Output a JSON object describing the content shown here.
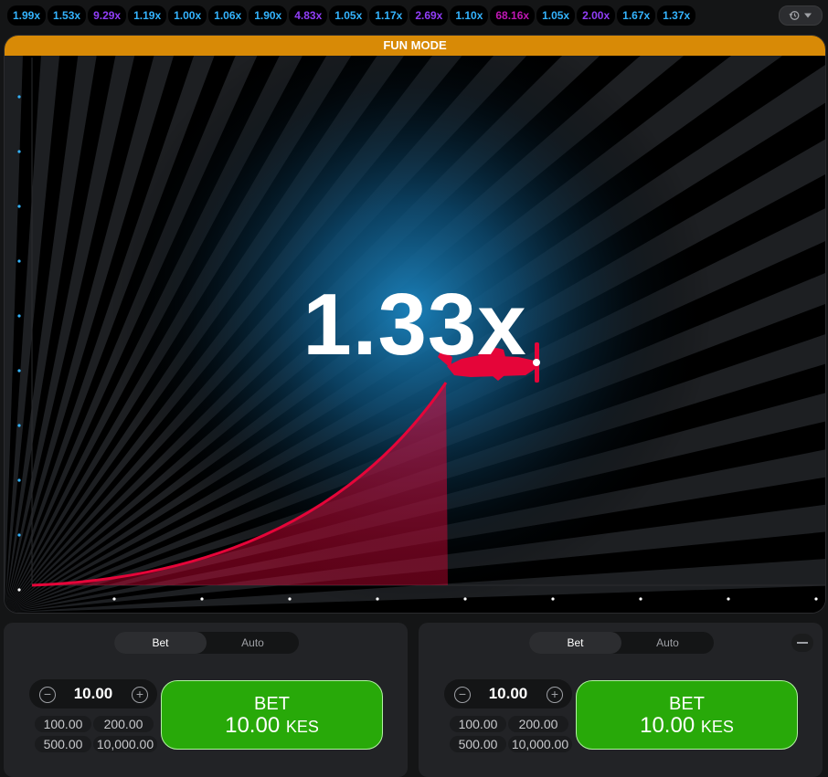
{
  "history": {
    "items": [
      {
        "label": "1.99x",
        "tier": "blue"
      },
      {
        "label": "1.53x",
        "tier": "blue"
      },
      {
        "label": "9.29x",
        "tier": "purple"
      },
      {
        "label": "1.19x",
        "tier": "blue"
      },
      {
        "label": "1.00x",
        "tier": "blue"
      },
      {
        "label": "1.06x",
        "tier": "blue"
      },
      {
        "label": "1.90x",
        "tier": "blue"
      },
      {
        "label": "4.83x",
        "tier": "purple"
      },
      {
        "label": "1.05x",
        "tier": "blue"
      },
      {
        "label": "1.17x",
        "tier": "blue"
      },
      {
        "label": "2.69x",
        "tier": "purple"
      },
      {
        "label": "1.10x",
        "tier": "blue"
      },
      {
        "label": "68.16x",
        "tier": "pink"
      },
      {
        "label": "1.05x",
        "tier": "blue"
      },
      {
        "label": "2.00x",
        "tier": "purple"
      },
      {
        "label": "1.67x",
        "tier": "blue"
      },
      {
        "label": "1.37x",
        "tier": "blue"
      }
    ],
    "button_icons": [
      "history-clock-icon",
      "chevron-down-icon"
    ]
  },
  "game": {
    "banner": "FUN MODE",
    "multiplier": "1.33x"
  },
  "panels": [
    {
      "tabs": [
        "Bet",
        "Auto"
      ],
      "active_tab": 0,
      "stake": "10.00",
      "quick_amounts": [
        "100.00",
        "200.00",
        "500.00",
        "10,000.00"
      ],
      "bet_label": "BET",
      "bet_amount": "10.00",
      "bet_currency": "KES",
      "has_remove": false
    },
    {
      "tabs": [
        "Bet",
        "Auto"
      ],
      "active_tab": 0,
      "stake": "10.00",
      "quick_amounts": [
        "100.00",
        "200.00",
        "500.00",
        "10,000.00"
      ],
      "bet_label": "BET",
      "bet_amount": "10.00",
      "bet_currency": "KES",
      "has_remove": true
    }
  ],
  "colors": {
    "blue": "#34b4ff",
    "purple": "#913ef8",
    "pink": "#c017b4",
    "banner": "#d88a06",
    "plane": "#e50539",
    "bet_green": "#28a909"
  }
}
